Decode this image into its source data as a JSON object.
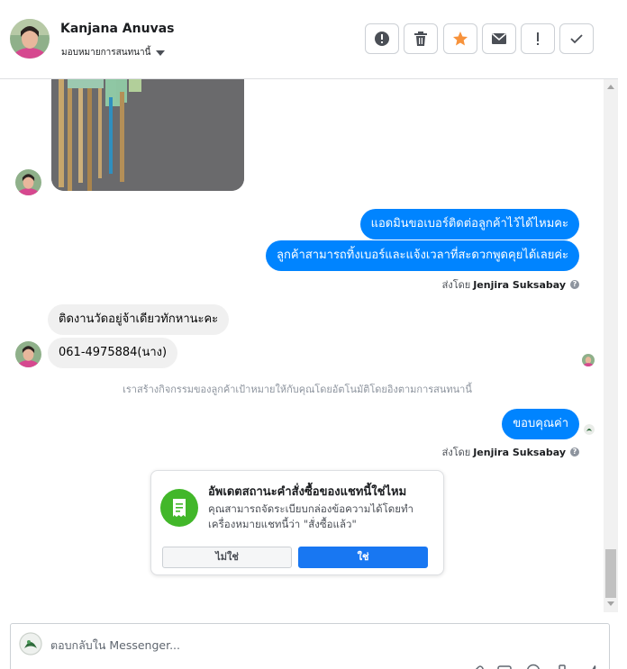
{
  "header": {
    "name": "Kanjana Anuvas",
    "assign_label": "มอบหมายการสนทนานี้",
    "toolbar": [
      {
        "id": "spam",
        "icon": "alert-circle-icon"
      },
      {
        "id": "delete",
        "icon": "trash-icon"
      },
      {
        "id": "star",
        "icon": "star-icon",
        "color": "#f7923b"
      },
      {
        "id": "unread",
        "icon": "envelope-icon"
      },
      {
        "id": "follow-up",
        "icon": "exclamation-icon"
      },
      {
        "id": "done",
        "icon": "checkmark-icon"
      }
    ]
  },
  "conversation": {
    "messages_out_1": [
      "แอดมินขอเบอร์ติดต่อลูกค้าไว้ได้ไหมคะ",
      "ลูกค้าสามารถทิ้งเบอร์และแจ้งเวลาที่สะดวกพูดคุยได้เลยค่ะ"
    ],
    "sent_by_1": {
      "prefix": "ส่งโดย",
      "name": "Jenjira Suksabay"
    },
    "messages_in": [
      "ติดงานวัดอยู่จ้าเดียวทักหานะคะ",
      "061-4975884(นาง)"
    ],
    "system_note": "เราสร้างกิจกรรมของลูกค้าเป้าหมายให้กับคุณโดยอัตโนมัติโดยอิงตามการสนทนานี้",
    "messages_out_2": [
      "ขอบคุณค่า"
    ],
    "sent_by_2": {
      "prefix": "ส่งโดย",
      "name": "Jenjira Suksabay"
    }
  },
  "card": {
    "title": "อัพเดตสถานะคำสั่งซื้อของแชทนี้ใช่ไหม",
    "body": "คุณสามารถจัดระเบียบกล่องข้อความได้โดยทำเครื่องหมายแชทนี้ว่า \"สั่งซื้อแล้ว\"",
    "no_label": "ไม่ใช่",
    "yes_label": "ใช่",
    "icon": "receipt-icon"
  },
  "composer": {
    "placeholder": "ตอบกลับใน Messenger..."
  },
  "colors": {
    "accent": "#0084ff",
    "button_blue": "#1877f2",
    "card_icon_green": "#42b72a"
  }
}
